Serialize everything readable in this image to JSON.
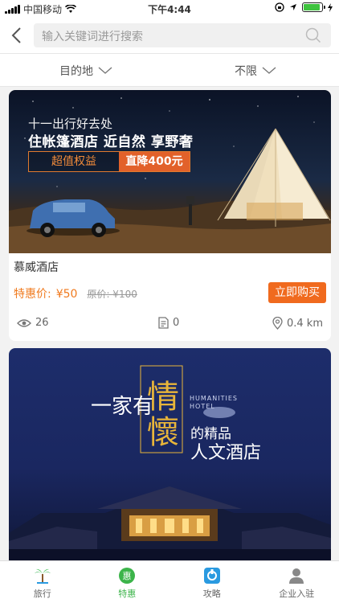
{
  "status_bar": {
    "carrier": "中国移动",
    "time": "下午4:44"
  },
  "search": {
    "placeholder": "输入关键词进行搜索"
  },
  "filters": {
    "destination": "目的地",
    "any": "不限"
  },
  "listings": [
    {
      "banner_line1": "十一出行好去处",
      "banner_line2": "住帐篷酒店 近自然 享野奢",
      "banner_tag1": "超值权益",
      "banner_tag2": "直降400元",
      "title": "慕威酒店",
      "price_label": "特惠价:",
      "price": "¥50",
      "original_price": "原价: ¥100",
      "buy_label": "立即购买",
      "views": "26",
      "reviews": "0",
      "distance": "0.4 km"
    },
    {
      "banner_a": "一家有",
      "banner_b": "情",
      "banner_c": "懷",
      "banner_d": "的精品",
      "banner_e": "人文酒店",
      "banner_en1": "HUMANITIES",
      "banner_en2": "HOTEL"
    }
  ],
  "tabs": [
    {
      "label": "旅行",
      "icon": "palm-tree-icon"
    },
    {
      "label": "特惠",
      "icon": "discount-icon"
    },
    {
      "label": "攻略",
      "icon": "guide-icon"
    },
    {
      "label": "企业入驻",
      "icon": "user-icon"
    }
  ],
  "colors": {
    "accent_orange": "#f06a1e",
    "tab_active": "#3cb44a",
    "tab_guide": "#2a9ae0"
  }
}
